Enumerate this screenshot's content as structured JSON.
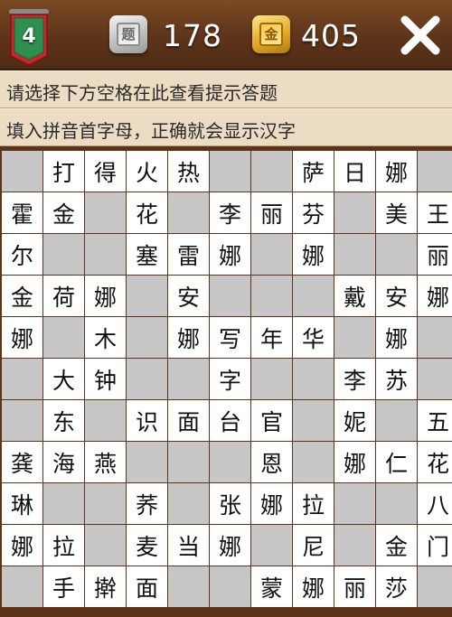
{
  "header": {
    "level": "4",
    "silver_coin_glyph": "题",
    "silver_count": "178",
    "gold_coin_glyph": "金",
    "gold_count": "405",
    "close_symbol": "✕"
  },
  "hints": [
    "请选择下方空格在此查看提示答题",
    "填入拼音首字母，正确就会显示汉字"
  ],
  "colors": {
    "wood": "#6b3f1f",
    "hint_bg": "#ecdcc4",
    "empty_cell": "#c7c7c7",
    "filled_cell": "#ffffff",
    "badge_red": "#c9262c",
    "badge_green": "#2f8f4e"
  },
  "grid": [
    [
      "",
      "打",
      "得",
      "火",
      "热",
      "",
      "",
      "萨",
      "日",
      "娜",
      ""
    ],
    [
      "霍",
      "金",
      "",
      "花",
      "",
      "李",
      "丽",
      "芬",
      "",
      "美",
      "王"
    ],
    [
      "尔",
      "",
      "",
      "塞",
      "雷",
      "娜",
      "",
      "娜",
      "",
      "",
      "丽"
    ],
    [
      "金",
      "荷",
      "娜",
      "",
      "安",
      "",
      "",
      "",
      "戴",
      "安",
      "娜"
    ],
    [
      "娜",
      "",
      "木",
      "",
      "娜",
      "写",
      "年",
      "华",
      "",
      "娜",
      ""
    ],
    [
      "",
      "大",
      "钟",
      "",
      "",
      "字",
      "",
      "",
      "李",
      "苏",
      ""
    ],
    [
      "",
      "东",
      "",
      "识",
      "面",
      "台",
      "官",
      "",
      "妮",
      "",
      "五"
    ],
    [
      "龚",
      "海",
      "燕",
      "",
      "",
      "",
      "恩",
      "",
      "娜",
      "仁",
      "花"
    ],
    [
      "琳",
      "",
      "",
      "荞",
      "",
      "张",
      "娜",
      "拉",
      "",
      "",
      "八"
    ],
    [
      "娜",
      "拉",
      "",
      "麦",
      "当",
      "娜",
      "",
      "尼",
      "",
      "金",
      "门"
    ],
    [
      "",
      "手",
      "擀",
      "面",
      "",
      "",
      "蒙",
      "娜",
      "丽",
      "莎",
      ""
    ]
  ],
  "open_cells": [
    [
      0,
      1
    ],
    [
      0,
      2
    ],
    [
      0,
      3
    ],
    [
      0,
      4
    ],
    [
      0,
      7
    ],
    [
      0,
      8
    ],
    [
      0,
      9
    ],
    [
      1,
      0
    ],
    [
      1,
      1
    ],
    [
      1,
      3
    ],
    [
      1,
      5
    ],
    [
      1,
      6
    ],
    [
      1,
      7
    ],
    [
      1,
      9
    ],
    [
      1,
      10
    ],
    [
      2,
      0
    ],
    [
      2,
      3
    ],
    [
      2,
      4
    ],
    [
      2,
      5
    ],
    [
      2,
      7
    ],
    [
      2,
      10
    ],
    [
      3,
      0
    ],
    [
      3,
      1
    ],
    [
      3,
      2
    ],
    [
      3,
      4
    ],
    [
      3,
      8
    ],
    [
      3,
      9
    ],
    [
      3,
      10
    ],
    [
      4,
      0
    ],
    [
      4,
      2
    ],
    [
      4,
      4
    ],
    [
      4,
      5
    ],
    [
      4,
      6
    ],
    [
      4,
      7
    ],
    [
      4,
      9
    ],
    [
      5,
      1
    ],
    [
      5,
      2
    ],
    [
      5,
      5
    ],
    [
      5,
      8
    ],
    [
      5,
      9
    ],
    [
      6,
      1
    ],
    [
      6,
      3
    ],
    [
      6,
      4
    ],
    [
      6,
      5
    ],
    [
      6,
      6
    ],
    [
      6,
      8
    ],
    [
      6,
      10
    ],
    [
      7,
      0
    ],
    [
      7,
      1
    ],
    [
      7,
      2
    ],
    [
      7,
      6
    ],
    [
      7,
      8
    ],
    [
      7,
      9
    ],
    [
      7,
      10
    ],
    [
      8,
      0
    ],
    [
      8,
      3
    ],
    [
      8,
      5
    ],
    [
      8,
      6
    ],
    [
      8,
      7
    ],
    [
      8,
      10
    ],
    [
      9,
      0
    ],
    [
      9,
      1
    ],
    [
      9,
      3
    ],
    [
      9,
      4
    ],
    [
      9,
      5
    ],
    [
      9,
      7
    ],
    [
      9,
      9
    ],
    [
      9,
      10
    ],
    [
      10,
      1
    ],
    [
      10,
      2
    ],
    [
      10,
      3
    ],
    [
      10,
      6
    ],
    [
      10,
      7
    ],
    [
      10,
      8
    ],
    [
      10,
      9
    ]
  ]
}
